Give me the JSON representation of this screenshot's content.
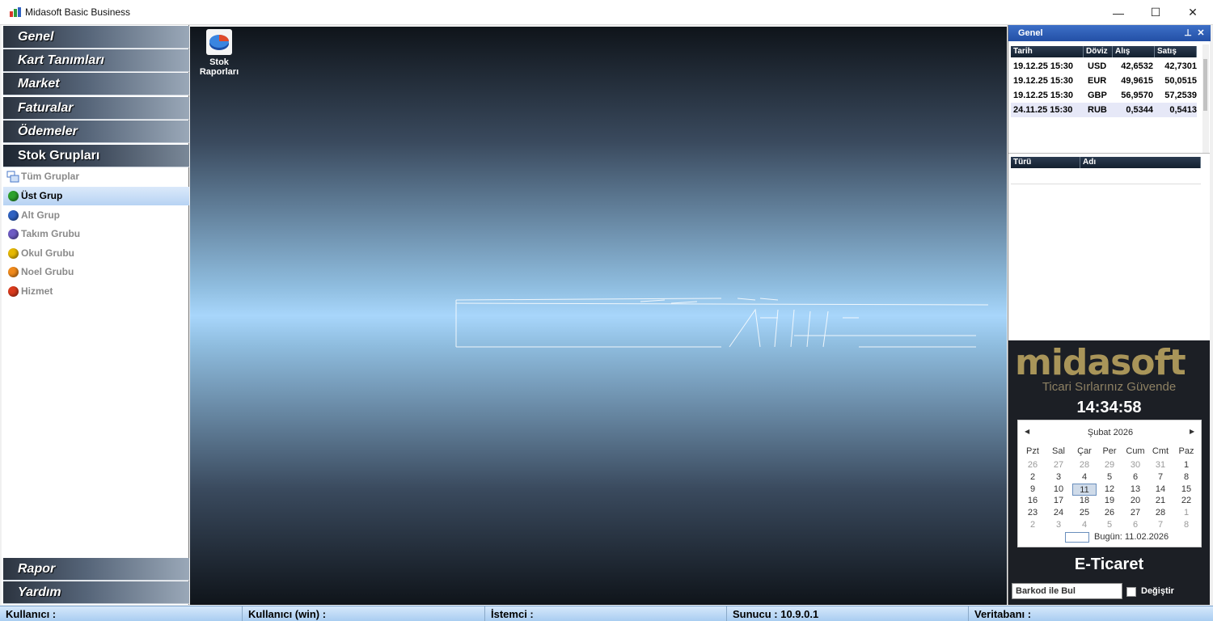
{
  "window": {
    "title": "Midasoft Basic Business",
    "minimize_glyph": "—",
    "maximize_glyph": "☐",
    "close_glyph": "✕"
  },
  "nav": {
    "top_buttons": [
      "Genel",
      "Kart Tanımları",
      "Market",
      "Faturalar",
      "Ödemeler",
      "Stok Grupları"
    ],
    "bottom_buttons": [
      "Rapor",
      "Yardım"
    ],
    "groups": [
      {
        "label": "Tüm Gruplar",
        "icon": "all-groups-icon",
        "color": "#4a78c9"
      },
      {
        "label": "Üst Grup",
        "icon": "green-dot-icon",
        "color": "#2da12d"
      },
      {
        "label": "Alt Grup",
        "icon": "blue-dot-icon",
        "color": "#2f62c2"
      },
      {
        "label": "Takım Grubu",
        "icon": "purple-dot-icon",
        "color": "#6d5bc4"
      },
      {
        "label": "Okul Grubu",
        "icon": "yellow-dot-icon",
        "color": "#e6b800"
      },
      {
        "label": "Noel Grubu",
        "icon": "orange-dot-icon",
        "color": "#f08a1c"
      },
      {
        "label": "Hizmet",
        "icon": "red-dot-icon",
        "color": "#d93a1c"
      }
    ]
  },
  "desktop": {
    "stok_label_1": "Stok",
    "stok_label_2": "Raporları"
  },
  "panel": {
    "title": "Genel",
    "pin_glyph": "📌",
    "close_glyph": "✕",
    "rate_headers": [
      "Tarih",
      "Döviz",
      "Alış",
      "Satış"
    ],
    "rates": [
      {
        "tarih": "19.12.25 15:30",
        "doviz": "USD",
        "alis": "42,6532",
        "satis": "42,7301"
      },
      {
        "tarih": "19.12.25 15:30",
        "doviz": "EUR",
        "alis": "49,9615",
        "satis": "50,0515"
      },
      {
        "tarih": "19.12.25 15:30",
        "doviz": "GBP",
        "alis": "56,9570",
        "satis": "57,2539"
      },
      {
        "tarih": "24.11.25 15:30",
        "doviz": "RUB",
        "alis": "0,5344",
        "satis": "0,5413"
      }
    ],
    "list_headers": [
      "Türü",
      "Adı"
    ]
  },
  "brand": {
    "logo": "midasoft",
    "slogan": "Ticari Sırlarınız Güvende",
    "clock": "14:34:58",
    "eticaret": "E-Ticaret",
    "barkod_placeholder": "Barkod ile Bul",
    "degistir": "Değiştir",
    "accent": "#a99559"
  },
  "calendar": {
    "month": "Şubat 2026",
    "dows": [
      "Pzt",
      "Sal",
      "Çar",
      "Per",
      "Cum",
      "Cmt",
      "Paz"
    ],
    "weeks": [
      [
        "26",
        "27",
        "28",
        "29",
        "30",
        "31",
        "1"
      ],
      [
        "2",
        "3",
        "4",
        "5",
        "6",
        "7",
        "8"
      ],
      [
        "9",
        "10",
        "11",
        "12",
        "13",
        "14",
        "15"
      ],
      [
        "16",
        "17",
        "18",
        "19",
        "20",
        "21",
        "22"
      ],
      [
        "23",
        "24",
        "25",
        "26",
        "27",
        "28",
        "1"
      ],
      [
        "2",
        "3",
        "4",
        "5",
        "6",
        "7",
        "8"
      ]
    ],
    "today_label": "Bugün: 11.02.2026",
    "selected": "11"
  },
  "status": {
    "kullanici": "Kullanıcı :",
    "kullanici_win": "Kullanıcı (win) :",
    "istemci": "İstemci :",
    "sunucu": "Sunucu : 10.9.0.1",
    "veritabani": "Veritabanı :"
  }
}
